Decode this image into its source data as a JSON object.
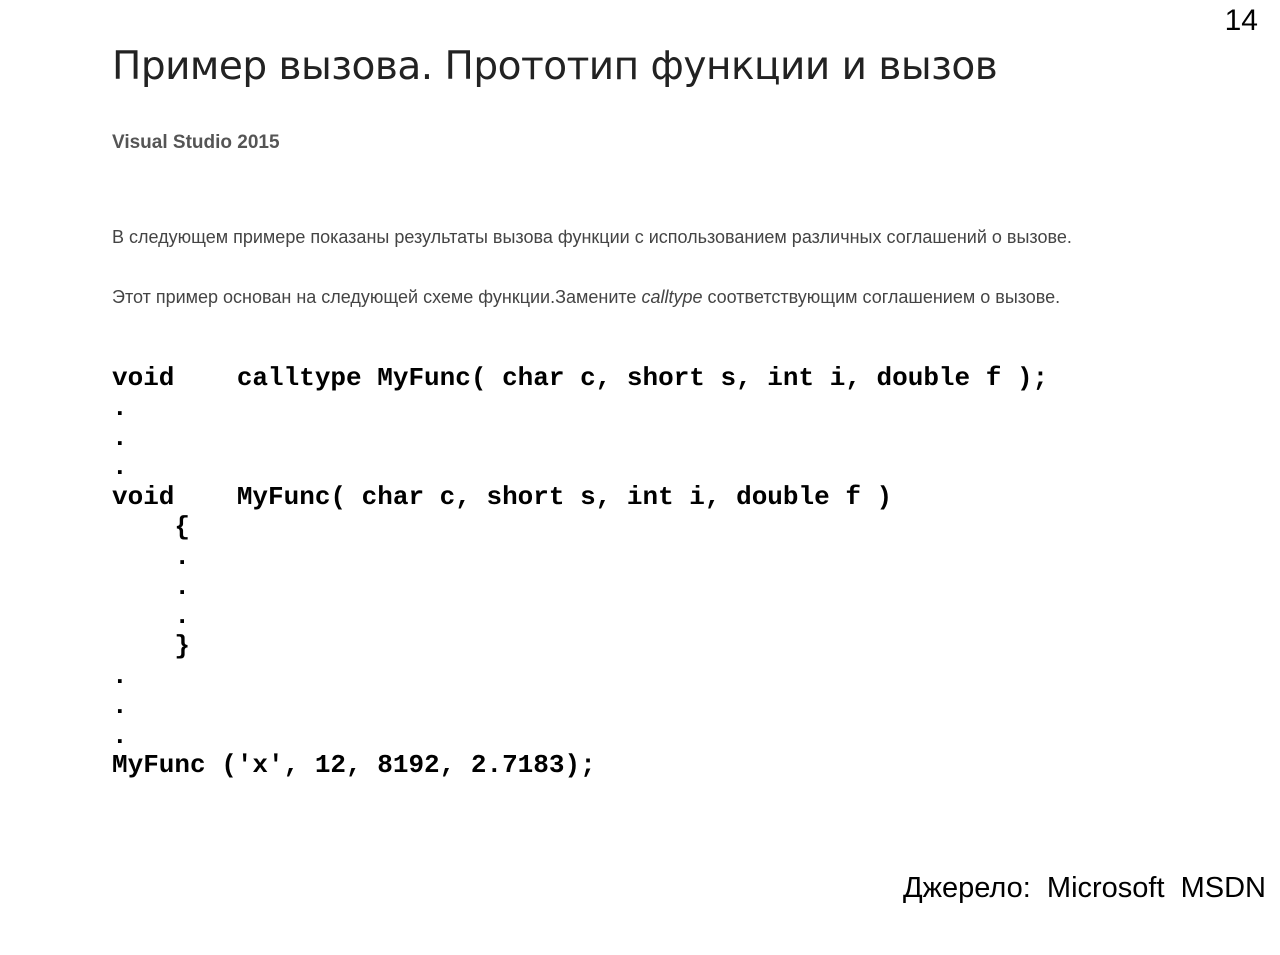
{
  "slide_number": "14",
  "title": "Пример вызова. Прототип функции и вызов",
  "subtitle": "Visual Studio 2015",
  "paragraph1": "В следующем примере показаны результаты вызова функции с использованием различных соглашений о вызове.",
  "paragraph2": {
    "before": "Этот пример основан на следующей схеме функции.Замените ",
    "italic": "calltype",
    "after": " соответствующим соглашением о вызове."
  },
  "code_lines": [
    "void    calltype MyFunc( char c, short s, int i, double f );",
    ".",
    ".",
    ".",
    "void    MyFunc( char c, short s, int i, double f )",
    "    {",
    "    .",
    "    .",
    "    .",
    "    }",
    ".",
    ".",
    ".",
    "MyFunc ('x', 12, 8192, 2.7183);"
  ],
  "source": "Джерело:  Microsoft  MSDN"
}
